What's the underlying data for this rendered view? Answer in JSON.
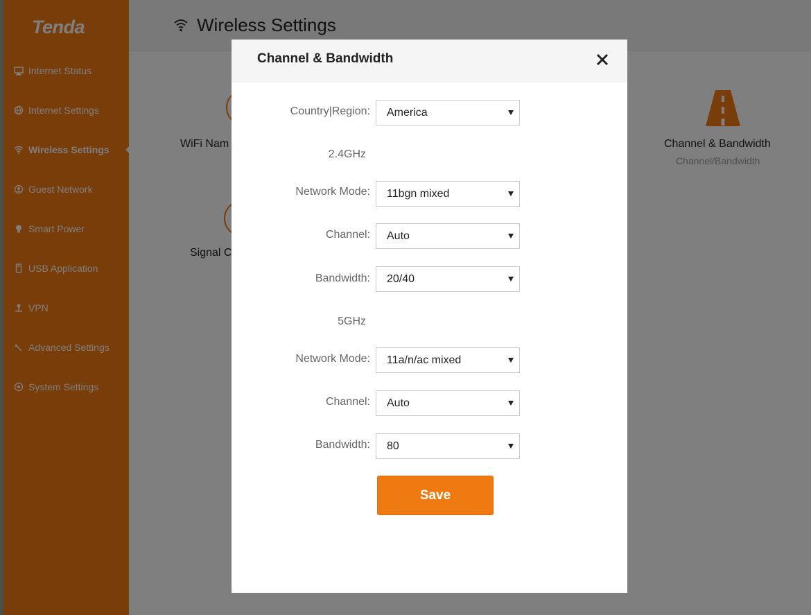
{
  "brand": {
    "logo_text": "Tenda",
    "accent_color": "#f07a12"
  },
  "sidebar": {
    "items": [
      {
        "label": "Internet Status",
        "icon": "monitor-icon"
      },
      {
        "label": "Internet Settings",
        "icon": "globe-icon"
      },
      {
        "label": "Wireless Settings",
        "icon": "wifi-icon",
        "active": true
      },
      {
        "label": "Guest Network",
        "icon": "guest-icon"
      },
      {
        "label": "Smart Power",
        "icon": "power-bulb-icon"
      },
      {
        "label": "USB Application",
        "icon": "usb-icon"
      },
      {
        "label": "VPN",
        "icon": "vpn-icon"
      },
      {
        "label": "Advanced Settings",
        "icon": "wrench-icon"
      },
      {
        "label": "System Settings",
        "icon": "gear-icon"
      }
    ]
  },
  "header": {
    "title": "Wireless Settings",
    "icon": "wifi-icon"
  },
  "background_tiles": {
    "wifi_name_label": "WiFi Nam",
    "signal_label": "Signal C",
    "channel_bandwidth_label": "Channel & Bandwidth",
    "channel_bandwidth_sub": "Channel/Bandwidth",
    "channel_bandwidth_icon": "road-icon"
  },
  "modal": {
    "title": "Channel & Bandwidth",
    "close_icon": "close-icon",
    "country": {
      "label": "Country|Region:",
      "value": "America"
    },
    "band_24": {
      "heading": "2.4GHz",
      "network_mode": {
        "label": "Network Mode:",
        "value": "11bgn mixed"
      },
      "channel": {
        "label": "Channel:",
        "value": "Auto"
      },
      "bandwidth": {
        "label": "Bandwidth:",
        "value": "20/40"
      }
    },
    "band_5": {
      "heading": "5GHz",
      "network_mode": {
        "label": "Network Mode:",
        "value": "11a/n/ac mixed"
      },
      "channel": {
        "label": "Channel:",
        "value": "Auto"
      },
      "bandwidth": {
        "label": "Bandwidth:",
        "value": "80"
      }
    },
    "save_label": "Save"
  }
}
